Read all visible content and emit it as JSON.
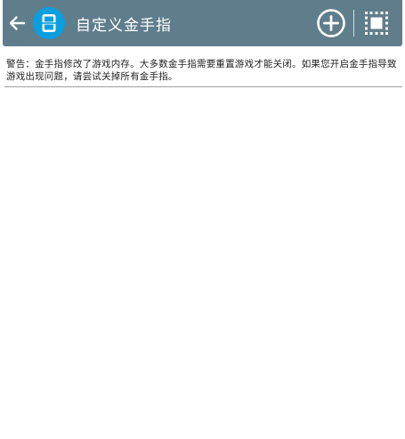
{
  "toolbar": {
    "title": "自定义金手指",
    "back_icon": "arrow-left-icon",
    "logo_icon": "handheld-console-icon",
    "add_icon": "circle-plus-icon",
    "select_icon": "select-all-icon",
    "colors": {
      "bar": "#607d8b",
      "logo_bg": "#0a9fe0",
      "foreground": "#ffffff"
    }
  },
  "warning": {
    "text": "警告：金手指修改了游戏内存。大多数金手指需要重置游戏才能关闭。如果您开启金手指导致游戏出现问题，请尝试关掉所有金手指。"
  },
  "cheat_list": {
    "items": []
  }
}
